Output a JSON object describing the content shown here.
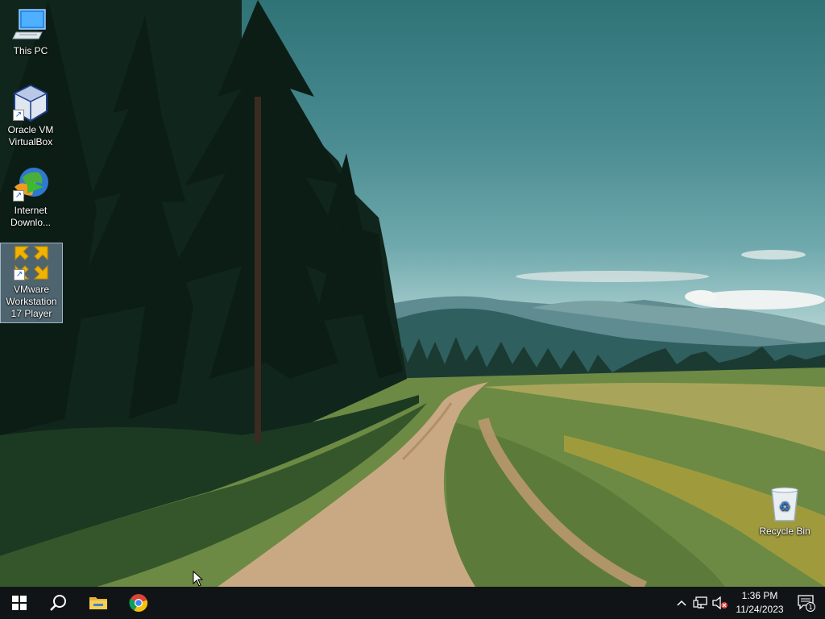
{
  "desktop": {
    "icons": [
      {
        "label": "This PC",
        "icon": "this-pc-icon"
      },
      {
        "label": "Oracle VM VirtualBox",
        "icon": "virtualbox-icon"
      },
      {
        "label": "Internet Downlo...",
        "icon": "internet-download-manager-icon"
      },
      {
        "label": "VMware Workstation 17 Player",
        "icon": "vmware-player-icon",
        "selected": true
      },
      {
        "label": "Recycle Bin",
        "icon": "recycle-bin-icon"
      }
    ]
  },
  "taskbar": {
    "start": {
      "icon": "windows-start-icon"
    },
    "search": {
      "icon": "search-icon"
    },
    "pinned": [
      {
        "app": "File Explorer",
        "icon": "folder-icon"
      },
      {
        "app": "Google Chrome",
        "icon": "chrome-icon"
      }
    ],
    "tray": {
      "icons": [
        "chevron-up-icon",
        "network-icon",
        "volume-muted-icon"
      ],
      "time": "1:36 PM",
      "date": "11/24/2023",
      "notifications_count": "1"
    }
  }
}
